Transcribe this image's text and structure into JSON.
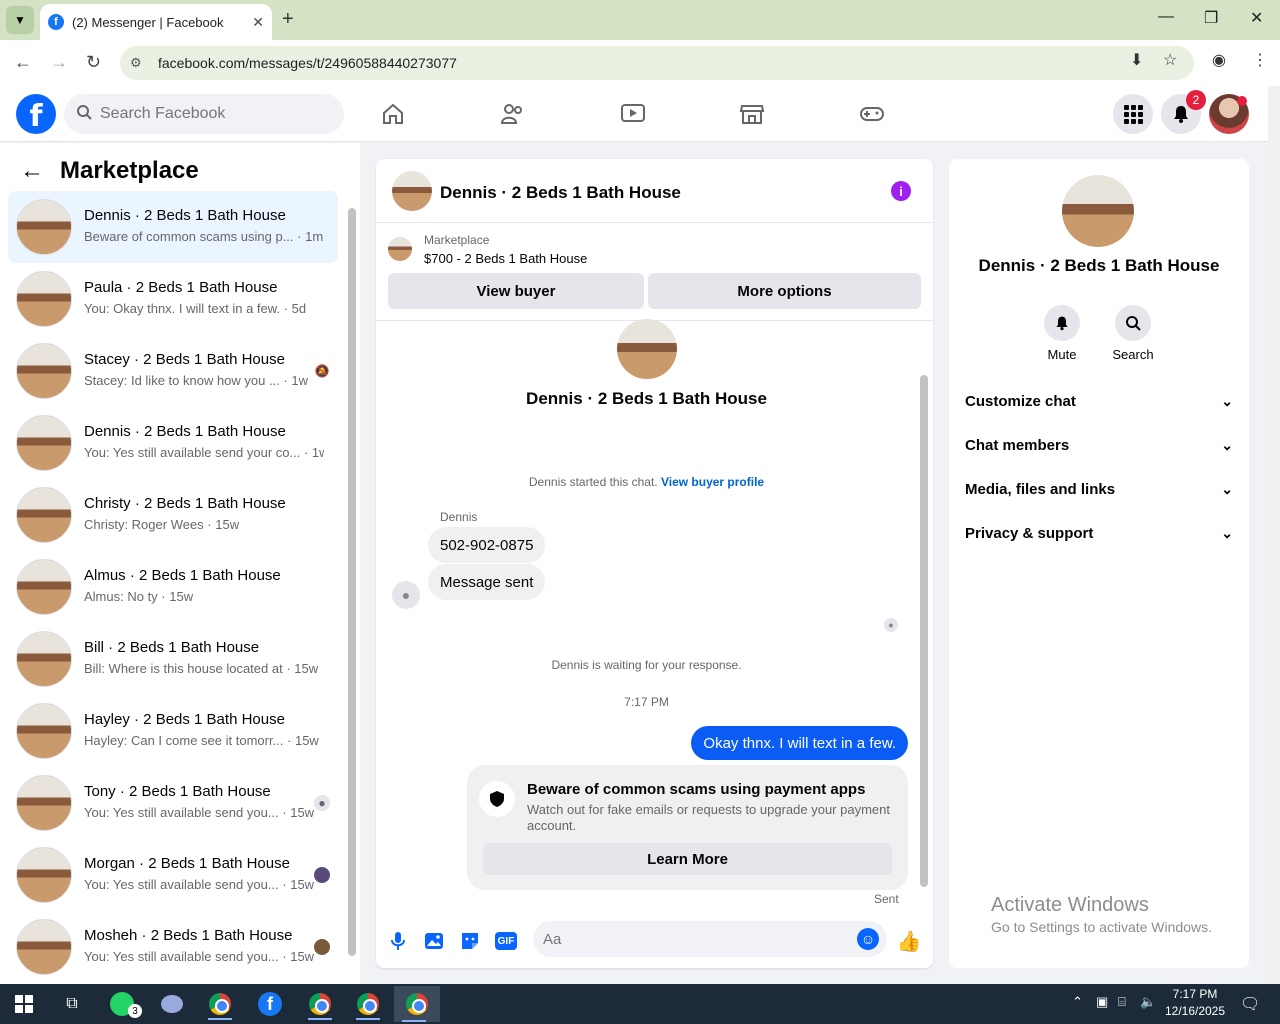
{
  "browser": {
    "tab_title": "(2) Messenger | Facebook",
    "url": "facebook.com/messages/t/24960588440273077"
  },
  "fb": {
    "search_placeholder": "Search Facebook",
    "notification_count": "2"
  },
  "left": {
    "title": "Marketplace",
    "conversations": [
      {
        "name": "Dennis · 2 Beds 1 Bath House",
        "snippet": "Beware of common scams using p... · 1m"
      },
      {
        "name": "Paula · 2 Beds 1 Bath House",
        "snippet": "You: Okay thnx. I will text in a few. · 5d"
      },
      {
        "name": "Stacey · 2 Beds 1 Bath House",
        "snippet": "Stacey: Id like to know how you ... · 1w"
      },
      {
        "name": "Dennis · 2 Beds 1 Bath House",
        "snippet": "You: Yes still available send your co... · 1w"
      },
      {
        "name": "Christy · 2 Beds 1 Bath House",
        "snippet": "Christy: Roger Wees · 15w"
      },
      {
        "name": "Almus · 2 Beds 1 Bath House",
        "snippet": "Almus: No ty · 15w"
      },
      {
        "name": "Bill · 2 Beds 1 Bath House",
        "snippet": "Bill: Where is this house located at · 15w"
      },
      {
        "name": "Hayley · 2 Beds 1 Bath House",
        "snippet": "Hayley: Can I come see it tomorr... · 15w"
      },
      {
        "name": "Tony · 2 Beds 1 Bath House",
        "snippet": "You: Yes still available send you... · 15w"
      },
      {
        "name": "Morgan · 2 Beds 1 Bath House",
        "snippet": "You: Yes still available send you... · 15w"
      },
      {
        "name": "Mosheh · 2 Beds 1 Bath House",
        "snippet": "You: Yes still available send you... · 15w"
      }
    ]
  },
  "chat": {
    "title": "Dennis · 2 Beds 1 Bath House",
    "marketplace_label": "Marketplace",
    "listing": "$700 - 2 Beds 1 Bath House",
    "view_buyer": "View buyer",
    "more_options": "More options",
    "started": "Dennis started this chat.",
    "view_buyer_profile": "View buyer profile",
    "sender": "Dennis",
    "msg1": "502-902-0875",
    "msg2": "Message sent",
    "waiting": "Dennis is waiting for your response.",
    "time": "7:17 PM",
    "out_msg": "Okay thnx. I will text in a few.",
    "scam_title": "Beware of common scams using payment apps",
    "scam_desc": "Watch out for fake emails or requests to upgrade your payment account.",
    "learn_more": "Learn More",
    "sent": "Sent",
    "input_placeholder": "Aa"
  },
  "right": {
    "name": "Dennis · 2 Beds 1 Bath House",
    "mute": "Mute",
    "search": "Search",
    "sections": [
      "Customize chat",
      "Chat members",
      "Media, files and links",
      "Privacy & support"
    ]
  },
  "watermark": {
    "line1": "Activate Windows",
    "line2": "Go to Settings to activate Windows."
  },
  "taskbar": {
    "time": "7:17 PM",
    "date": "12/16/2025",
    "whatsapp_badge": "3"
  }
}
